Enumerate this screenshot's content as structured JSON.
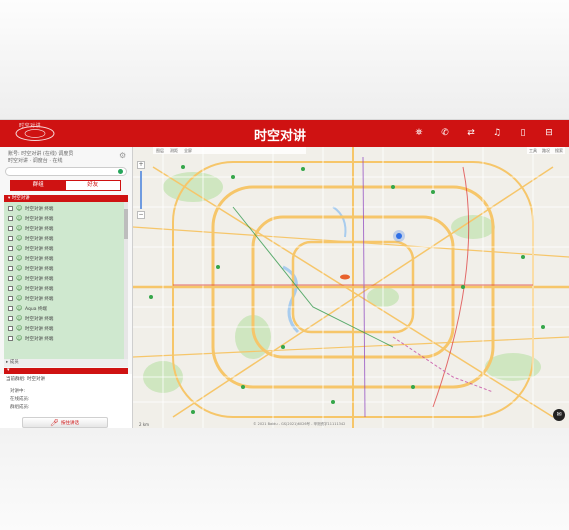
{
  "app": {
    "title": "时空对讲",
    "logo_text": "时空对讲",
    "titlebar_icons": [
      "contacts-icon",
      "phone-icon",
      "link-icon",
      "bell-icon",
      "window-icon",
      "close-icon"
    ]
  },
  "sidebar": {
    "user_line1": "账号: 时空对讲 (在线) 调度员",
    "user_line2": "时空对讲 · 调度台 · 在线",
    "search": {
      "placeholder": ""
    },
    "tabs": [
      {
        "label": "群组"
      },
      {
        "label": "好友"
      }
    ],
    "group_header": "▾ 时空对讲",
    "members": [
      "时空对讲 终端",
      "时空对讲 终端",
      "时空对讲 终端",
      "时空对讲 终端",
      "时空对讲 终端",
      "时空对讲 终端",
      "时空对讲 终端",
      "时空对讲 终端",
      "时空对讲 终端",
      "时空对讲 终端",
      "Aqua 终端",
      "时空对讲 终端",
      "时空对讲 终端",
      "时空对讲 终端"
    ],
    "members_bar": "▸ 成员",
    "expand_label": "▾",
    "panel": {
      "head": "当前群组: 时空对讲",
      "lines": [
        "对讲中:",
        "在线成员:",
        "群组成员:"
      ],
      "ptt_label": "按住讲话"
    }
  },
  "map": {
    "top_toolbar": [
      "图层",
      "测距",
      "全屏"
    ],
    "right_tools": [
      "工具",
      "路况",
      "搜索"
    ],
    "zoom_in": "+",
    "zoom_out": "−",
    "scale": "2 km",
    "copyright": "© 2021 Baidu - GS(2021)6026号 - 甲测资字11111342",
    "chat_icon": "chat-icon"
  },
  "colors": {
    "brand_red": "#cf1212",
    "list_green": "#cfe8cf",
    "road_yellow": "#f6c66a",
    "park_green": "#cfe6c0",
    "marker_blue": "#2f6fe6"
  }
}
